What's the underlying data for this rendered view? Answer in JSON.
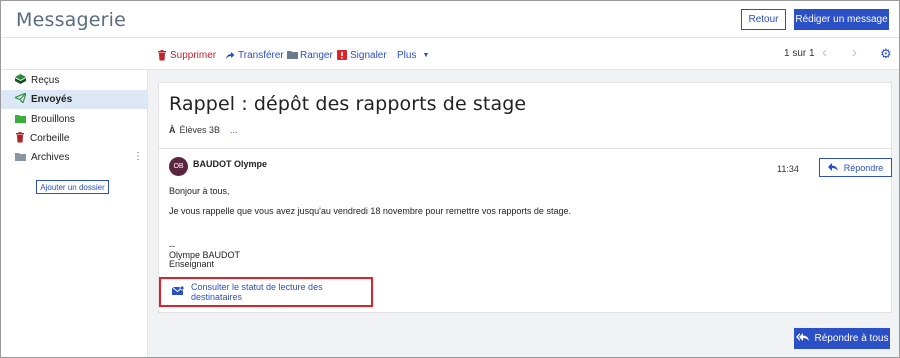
{
  "header": {
    "title": "Messagerie",
    "back_label": "Retour",
    "compose_label": "Rédiger un message"
  },
  "toolbar": {
    "delete_label": "Supprimer",
    "forward_label": "Transférer",
    "file_label": "Ranger",
    "report_label": "Signaler",
    "more_label": "Plus",
    "pager": "1 sur 1",
    "icons": [
      "trash-icon",
      "forward-arrow-icon",
      "folder-icon",
      "alert-icon",
      "chevron-down-icon",
      "chevron-left-icon",
      "chevron-right-icon",
      "gear-icon"
    ]
  },
  "sidebar": {
    "items": [
      {
        "label": "Reçus",
        "icon": "inbox-icon"
      },
      {
        "label": "Envoyés",
        "icon": "paper-plane-icon"
      },
      {
        "label": "Brouillons",
        "icon": "folder-icon"
      },
      {
        "label": "Corbeille",
        "icon": "trash-icon"
      },
      {
        "label": "Archives",
        "icon": "folder-icon"
      }
    ],
    "add_folder_label": "Ajouter un dossier"
  },
  "message": {
    "subject": "Rappel : dépôt des rapports de stage",
    "to_prefix": "À",
    "to": "Élèves 3B",
    "to_more": "...",
    "avatar_initials": "OB",
    "sender": "BAUDOT Olympe",
    "time": "11:34",
    "reply_label": "Répondre",
    "body": {
      "greeting": "Bonjour à tous,",
      "line1": "Je vous rappelle que vous avez jusqu'au vendredi 18 novembre pour remettre vos rapports de stage.",
      "sig_sep": "--",
      "sig_name": "Olympe BAUDOT",
      "sig_role": "Enseignant"
    },
    "read_status_label": "Consulter le statut de lecture des destinataires"
  },
  "footer": {
    "reply_all_label": "Répondre à tous"
  },
  "colors": {
    "accent": "#2b4fc4",
    "danger": "#e0212a",
    "active_bg": "#dde8f7",
    "avatar": "#5b2440"
  }
}
